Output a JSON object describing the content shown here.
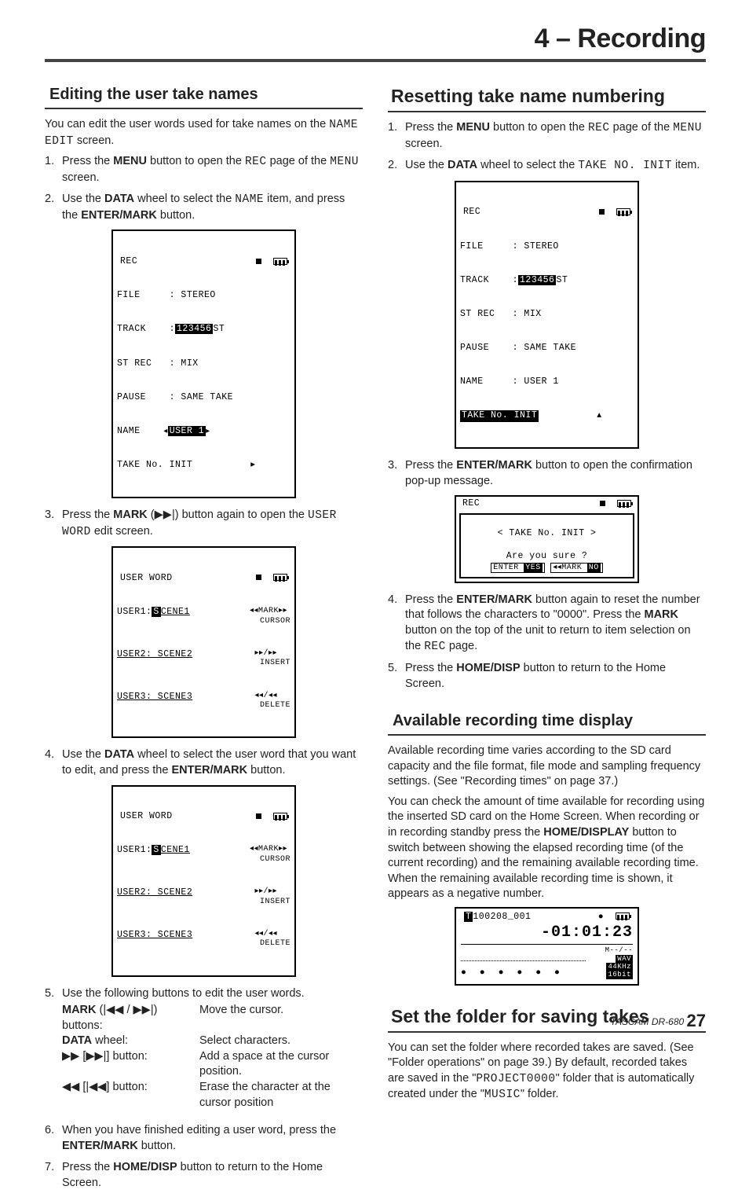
{
  "chapter": "4 – Recording",
  "left": {
    "h2": "Editing the user take names",
    "intro_a": "You can edit the user words used for take names on the ",
    "intro_code": "NAME EDIT",
    "intro_b": " screen.",
    "s1_a": "Press the ",
    "s1_b": "MENU",
    "s1_c": " button to open the ",
    "s1_code": "REC",
    "s1_d": " page of the ",
    "s1_code2": "MENU",
    "s1_e": " screen.",
    "s2_a": "Use the ",
    "s2_b": "DATA",
    "s2_c": " wheel to select the ",
    "s2_code": "NAME",
    "s2_d": " item, and press the ",
    "s2_e": "ENTER/MARK",
    "s2_f": " button.",
    "s3_a": "Press the ",
    "s3_b": "MARK",
    "s3_c": " (▶▶|) button again to open the ",
    "s3_code": "USER WORD",
    "s3_d": " edit screen.",
    "s4_a": "Use the ",
    "s4_b": "DATA",
    "s4_c": " wheel to select the user word that you want to edit, and press the ",
    "s4_d": "ENTER/MARK",
    "s4_e": " button.",
    "s5": "Use the following buttons to edit the user words.",
    "bt_r1a": "MARK",
    "bt_r1b": " (|◀◀ / ▶▶|) buttons:",
    "bt_r1v": "Move the cursor.",
    "bt_r2a": "DATA",
    "bt_r2b": " wheel:",
    "bt_r2v": "Select characters.",
    "bt_r3a": "▶▶ [▶▶|] button:",
    "bt_r3v": "Add a space at the cursor position.",
    "bt_r4a": "◀◀ [|◀◀] button:",
    "bt_r4v": "Erase the character at the cursor position",
    "s6_a": "When you have finished editing a user word, press the ",
    "s6_b": "ENTER/MARK",
    "s6_c": " button.",
    "s7_a": "Press the ",
    "s7_b": "HOME/DISP",
    "s7_c": " button to return to the Home Screen.",
    "lcd1": {
      "title": "REC",
      "l1": "FILE     : STEREO",
      "l2a": "TRACK    :",
      "l2inv": "123456",
      "l2b": "ST",
      "l3": "ST REC   : MIX",
      "l4": "PAUSE    : SAME TAKE",
      "l5a": "NAME    ",
      "l5inv": "USER 1",
      "l6": "TAKE No. INIT          ▸"
    },
    "lcd2": {
      "title": "USER WORD",
      "u1a": "USER1:",
      "u1inv": "S",
      "u1b": "CENE1",
      "r1": "◂◂MARK▸▸\n  CURSOR",
      "u2": "USER2: SCENE2",
      "r2": "▸▸/▸▸\n INSERT",
      "u3": "USER3: SCENE3",
      "r3": "◂◂/◂◂\n DELETE"
    }
  },
  "right": {
    "h2a": "Resetting take name numbering",
    "r1_a": "Press the ",
    "r1_b": "MENU",
    "r1_c": " button to open the ",
    "r1_code": "REC",
    "r1_d": " page of the ",
    "r1_code2": "MENU",
    "r1_e": " screen.",
    "r2_a": "Use the ",
    "r2_b": "DATA",
    "r2_c": " wheel to select the ",
    "r2_code": "TAKE NO. INIT",
    "r2_d": " item.",
    "lcdA": {
      "title": "REC",
      "l1": "FILE     : STEREO",
      "l2a": "TRACK    :",
      "l2inv": "123456",
      "l2b": "ST",
      "l3": "ST REC   : MIX",
      "l4": "PAUSE    : SAME TAKE",
      "l5": "NAME     : USER 1",
      "l6inv": "TAKE No. INIT",
      "l6b": "          ▴"
    },
    "r3_a": "Press the ",
    "r3_b": "ENTER/MARK",
    "r3_c": " button to open the confirmation pop-up message.",
    "lcdB": {
      "title": "REC",
      "line": "< TAKE No. INIT >",
      "ask": "Are you sure ?",
      "yes": "ENTER",
      "yes2": "YES",
      "no": "◂◂MARK",
      "no2": "NO"
    },
    "r4_a": "Press the ",
    "r4_b": "ENTER/MARK",
    "r4_c": " button again to reset the number that follows the characters to \"0000\". Press the ",
    "r4_d": "MARK",
    "r4_e": " button on the top of the unit to return to item selection on the ",
    "r4_code": "REC",
    "r4_f": " page.",
    "r5_a": "Press the ",
    "r5_b": "HOME/DISP",
    "r5_c": " button to return to the Home Screen.",
    "h2b": "Available recording time display",
    "pB1": "Available recording time varies according to the SD card capacity and the file format, file mode and sampling frequency settings. (See \"Recording times\" on page 37.)",
    "pB2_a": "You can check the amount of time available for recording using the inserted SD card on the Home Screen. When recording or in recording standby press the ",
    "pB2_b": "HOME/DISPLAY",
    "pB2_c": " button to switch between showing the elapsed recording time (of the current recording) and the remaining available recording time. When the remaining available recording time is shown, it appears as a negative number.",
    "lcdC": {
      "topinv": "T",
      "top": "100208_001",
      "time": "-01:01:23",
      "m": "M--/--",
      "r1": "WAV",
      "r2": "44KHz",
      "r3": "16bit",
      "bars": "● ● ● ● ● ●"
    },
    "h2c": "Set the folder for saving takes",
    "pC_a": "You can set the folder where recorded takes are saved. (See \"Folder operations\" on page 39.) By default, recorded takes are saved in the \"",
    "pC_code1": "PROJECT0000",
    "pC_b": "\" folder that is automatically created under the \"",
    "pC_code2": "MUSIC",
    "pC_c": "\" folder."
  },
  "footer_a": "TASCAM  DR-680 ",
  "footer_pg": "27"
}
